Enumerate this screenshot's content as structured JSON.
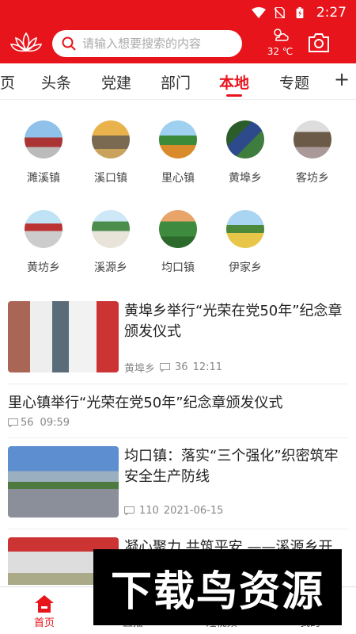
{
  "status_bar": {
    "time": "2:27"
  },
  "header": {
    "search_placeholder": "请输入想要搜索的内容",
    "weather_temp": "32 ℃",
    "accent_color": "#e8141c"
  },
  "tabs": [
    {
      "label": "页"
    },
    {
      "label": "头条"
    },
    {
      "label": "党建"
    },
    {
      "label": "部门"
    },
    {
      "label": "本地",
      "active": true
    },
    {
      "label": "专题"
    }
  ],
  "tab_more": "+",
  "towns": [
    {
      "label": "濉溪镇"
    },
    {
      "label": "溪口镇"
    },
    {
      "label": "里心镇"
    },
    {
      "label": "黄埠乡"
    },
    {
      "label": "客坊乡"
    },
    {
      "label": "黄坊乡"
    },
    {
      "label": "溪源乡"
    },
    {
      "label": "均口镇"
    },
    {
      "label": "伊家乡"
    }
  ],
  "news": [
    {
      "title": "黄埠乡举行“光荣在党50年”纪念章颁发仪式",
      "source": "黄埠乡",
      "comments": "36",
      "time": "12:11"
    },
    {
      "title": "里心镇举行“光荣在党50年”纪念章颁发仪式",
      "comments": "56",
      "time": "09:59"
    },
    {
      "title": "均口镇：落实“三个强化”织密筑牢安全生产防线",
      "comments": "110",
      "time": "2021-06-15"
    },
    {
      "title": "凝心聚力 共筑平安 ——溪源乡开"
    }
  ],
  "bottom_nav": [
    {
      "label": "首页",
      "active": true
    },
    {
      "label": "直播"
    },
    {
      "label": "短视频"
    },
    {
      "label": "我的"
    }
  ],
  "watermark": "下载鸟资源"
}
